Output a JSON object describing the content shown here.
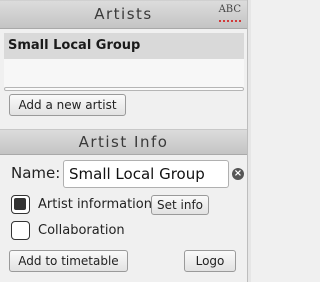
{
  "artists_panel": {
    "title": "Artists",
    "spellcheck_icon_text": "ABC",
    "list": {
      "items": [
        "Small Local Group"
      ],
      "selected_index": 0
    },
    "add_artist_label": "Add a new artist"
  },
  "artist_info": {
    "title": "Artist Info",
    "name_label": "Name:",
    "name_value": "Small Local Group",
    "artist_information_label": "Artist information",
    "artist_information_checked": true,
    "set_info_label": "Set info",
    "collaboration_label": "Collaboration",
    "collaboration_checked": false,
    "add_to_timetable_label": "Add to timetable",
    "logo_label": "Logo"
  },
  "colors": {
    "header_bg": "#c8c8c8",
    "selected_row_bg": "#d9d9d9",
    "panel_bg": "#f0f0f0"
  }
}
